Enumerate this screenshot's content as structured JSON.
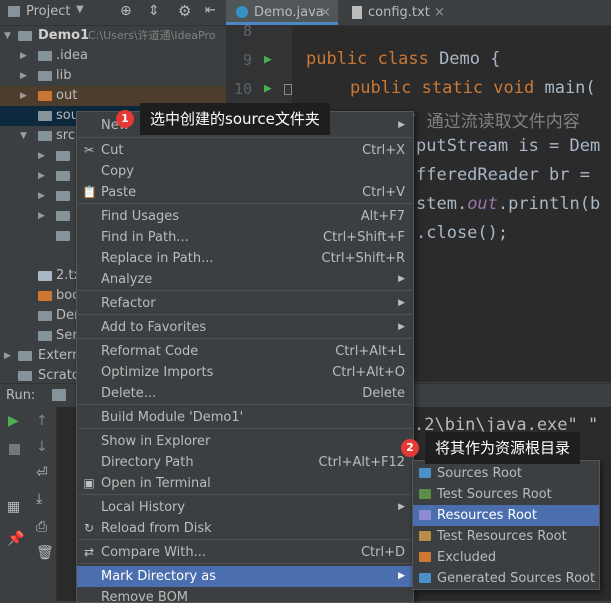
{
  "project_panel": {
    "title": "Project",
    "tree": [
      {
        "label": "Demo1",
        "path": "C:\\Users\\许道通\\IdeaPro",
        "color": "#87939a"
      },
      {
        "label": ".idea",
        "color": "#87939a"
      },
      {
        "label": "lib",
        "color": "#87939a"
      },
      {
        "label": "out",
        "color": "#cc7832"
      },
      {
        "label": "sou",
        "color": "#87939a"
      },
      {
        "label": "src",
        "color": "#87939a"
      },
      {
        "label": "",
        "color": "#87939a"
      },
      {
        "label": "",
        "color": "#87939a"
      },
      {
        "label": "",
        "color": "#87939a"
      },
      {
        "label": "",
        "color": "#87939a"
      },
      {
        "label": "",
        "color": "#87939a"
      },
      {
        "label": "2.tx",
        "color": "#a9b7c6"
      },
      {
        "label": "boo",
        "color": "#cc7832"
      },
      {
        "label": "Der",
        "color": "#87939a"
      },
      {
        "label": "Ser",
        "color": "#87939a"
      },
      {
        "label": "Extern",
        "color": "#87939a"
      },
      {
        "label": "Scratch",
        "color": "#87939a"
      }
    ]
  },
  "editor": {
    "tabs": [
      {
        "label": "Demo.java",
        "icon": "java-class-icon"
      },
      {
        "label": "config.txt",
        "icon": "text-file-icon"
      }
    ],
    "lines": [
      {
        "num": "8"
      },
      {
        "num": "9"
      },
      {
        "num": "10"
      }
    ],
    "code": {
      "l1_kw": "public class ",
      "l1_id": "Demo {",
      "l2_kw": "public static void ",
      "l2_id": "main(",
      "l3_cm": "// 通过流读取文件内容",
      "l4": "putStream is = Dem",
      "l5": "fferedReader br =",
      "l6_a": "stem.",
      "l6_b": "out",
      "l6_c": ".println(b",
      "l7": ".close();"
    }
  },
  "run_panel": {
    "label": "Run:",
    "console_text": ".2\\bin\\java.exe\" \""
  },
  "context_menu": {
    "items": [
      {
        "label": "New",
        "shortcut": "",
        "submenu": true
      },
      {
        "label": "Cut",
        "shortcut": "Ctrl+X",
        "icon": "scissors"
      },
      {
        "label": "Copy",
        "shortcut": ""
      },
      {
        "label": "Paste",
        "shortcut": "Ctrl+V",
        "icon": "clipboard"
      },
      {
        "label": "Find Usages",
        "shortcut": "Alt+F7"
      },
      {
        "label": "Find in Path...",
        "shortcut": "Ctrl+Shift+F"
      },
      {
        "label": "Replace in Path...",
        "shortcut": "Ctrl+Shift+R"
      },
      {
        "label": "Analyze",
        "shortcut": "",
        "submenu": true
      },
      {
        "label": "Refactor",
        "shortcut": "",
        "submenu": true
      },
      {
        "label": "Add to Favorites",
        "shortcut": "",
        "submenu": true
      },
      {
        "label": "Reformat Code",
        "shortcut": "Ctrl+Alt+L"
      },
      {
        "label": "Optimize Imports",
        "shortcut": "Ctrl+Alt+O"
      },
      {
        "label": "Delete...",
        "shortcut": "Delete"
      },
      {
        "label": "Build Module 'Demo1'",
        "shortcut": ""
      },
      {
        "label": "Show in Explorer",
        "shortcut": ""
      },
      {
        "label": "Directory Path",
        "shortcut": "Ctrl+Alt+F12"
      },
      {
        "label": "Open in Terminal",
        "shortcut": "",
        "icon": "terminal"
      },
      {
        "label": "Local History",
        "shortcut": "",
        "submenu": true
      },
      {
        "label": "Reload from Disk",
        "shortcut": "",
        "icon": "reload"
      },
      {
        "label": "Compare With...",
        "shortcut": "Ctrl+D",
        "icon": "compare"
      },
      {
        "label": "Mark Directory as",
        "shortcut": "",
        "submenu": true,
        "selected": true
      },
      {
        "label": "Remove BOM",
        "shortcut": ""
      }
    ]
  },
  "submenu": {
    "items": [
      {
        "label": "Sources Root",
        "color": "#4a8fc7"
      },
      {
        "label": "Test Sources Root",
        "color": "#5b8f49"
      },
      {
        "label": "Resources Root",
        "color": "#8f8ad4",
        "selected": true
      },
      {
        "label": "Test Resources Root",
        "color": "#b88c4a"
      },
      {
        "label": "Excluded",
        "color": "#cc7832"
      },
      {
        "label": "Generated Sources Root",
        "color": "#4a8fc7"
      }
    ]
  },
  "callouts": [
    {
      "num": "1",
      "text": "选中创建的source文件夹"
    },
    {
      "num": "2",
      "text": "将其作为资源根目录"
    }
  ],
  "colors": {
    "selection": "#4b6eaf",
    "badge": "#e53935"
  }
}
